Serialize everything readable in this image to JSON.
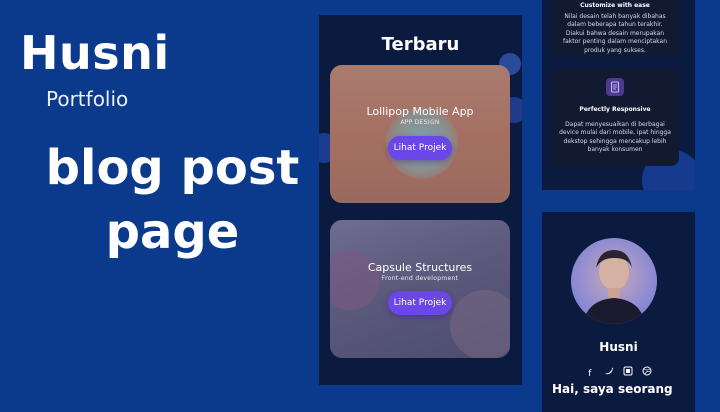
{
  "brand": {
    "name": "Husni",
    "subtitle": "Portfolio"
  },
  "hero": {
    "line1": "blog post",
    "line2": "page"
  },
  "mid_phone": {
    "title": "Terbaru",
    "cards": [
      {
        "title": "Lollipop Mobile App",
        "subtitle": "APP DESIGN",
        "button": "Lihat Projek"
      },
      {
        "title": "Capsule Structures",
        "subtitle": "Front-end development",
        "button": "Lihat Projek"
      }
    ]
  },
  "right_top": {
    "card1": {
      "title": "Customize with ease",
      "desc": "Nilai desain telah banyak dibahas dalam beberapa tahun terakhir. Diakui bahwa desain merupakan faktor penting dalam menciptakan produk yang sukses."
    },
    "card2": {
      "title": "Perfectly Responsive",
      "desc": "Dapat menyesuaikan di berbagai device mulai dari mobile, ipat hingga dekstop sehingga mencakup lebih banyak konsumen"
    }
  },
  "right_bottom": {
    "name": "Husni",
    "greeting": "Hai, saya seorang",
    "social_icons": [
      "facebook-icon",
      "twitter-icon",
      "instagram-icon",
      "dribbble-icon"
    ]
  },
  "colors": {
    "background": "#0b3a8c",
    "panel": "#0b1a3f",
    "button": "#6c47e8"
  }
}
